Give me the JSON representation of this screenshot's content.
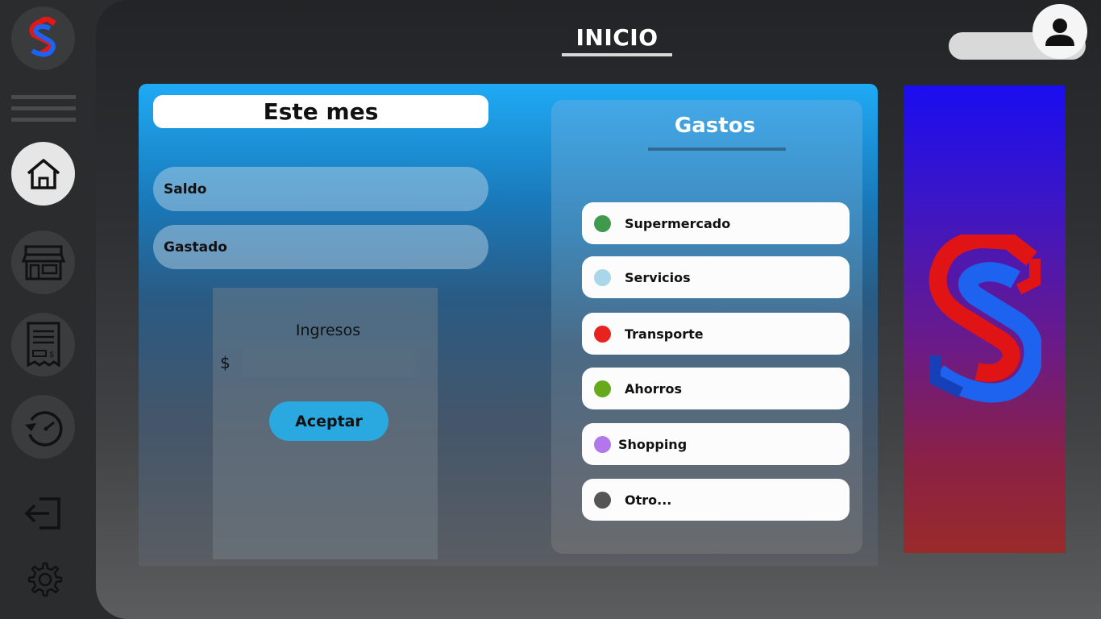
{
  "header": {
    "title": "INICIO"
  },
  "sidebar": {
    "items": [
      {
        "name": "home",
        "icon": "home-icon",
        "active": true
      },
      {
        "name": "store",
        "icon": "store-icon"
      },
      {
        "name": "receipt",
        "icon": "receipt-icon"
      },
      {
        "name": "history",
        "icon": "history-icon"
      },
      {
        "name": "logout",
        "icon": "logout-icon"
      },
      {
        "name": "settings",
        "icon": "gear-icon"
      }
    ]
  },
  "summary": {
    "month_label": "Este mes",
    "saldo_label": "Saldo",
    "gastado_label": "Gastado"
  },
  "income": {
    "title": "Ingresos",
    "currency": "$",
    "value": "",
    "accept_label": "Aceptar"
  },
  "gastos": {
    "title": "Gastos",
    "categories": [
      {
        "label": "Supermercado",
        "color": "#3f9a4c"
      },
      {
        "label": "Servicios",
        "color": "#a9d6e8"
      },
      {
        "label": "Transporte",
        "color": "#e8231f"
      },
      {
        "label": "Ahorros",
        "color": "#66aa1c"
      },
      {
        "label": "Shopping",
        "color": "#b277ea"
      },
      {
        "label": "Otro...",
        "color": "#555555"
      }
    ]
  },
  "colors": {
    "accent": "#29a9e0",
    "brand_red": "#e01818",
    "brand_blue": "#1e62f0"
  }
}
